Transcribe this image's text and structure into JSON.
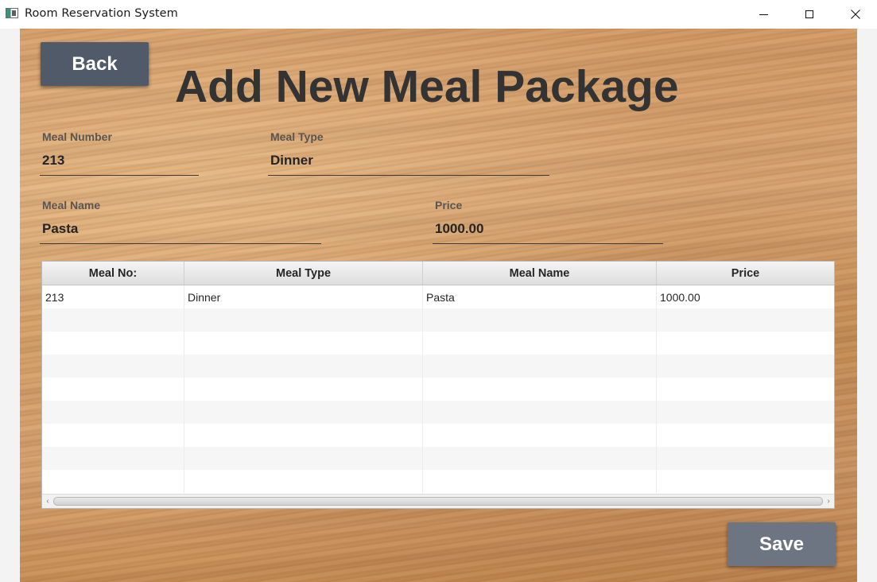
{
  "window": {
    "title": "Room Reservation System",
    "controls": {
      "minimize": "minimize-icon",
      "maximize": "maximize-icon",
      "close": "close-icon"
    }
  },
  "header": {
    "back_label": "Back",
    "title": "Add New Meal Package"
  },
  "form": {
    "meal_number": {
      "label": "Meal Number",
      "value": "213"
    },
    "meal_type": {
      "label": "Meal Type",
      "value": "Dinner"
    },
    "meal_name": {
      "label": "Meal Name",
      "value": "Pasta"
    },
    "price": {
      "label": "Price",
      "value": "1000.00"
    }
  },
  "table": {
    "columns": [
      "Meal No:",
      "Meal Type",
      "Meal Name",
      "Price"
    ],
    "rows": [
      [
        "213",
        "Dinner",
        "Pasta",
        "1000.00"
      ]
    ],
    "empty_rows_visible": 8
  },
  "footer": {
    "save_label": "Save"
  },
  "colors": {
    "back_button": "#515a69",
    "save_button": "#6d7582",
    "title_text": "#333333",
    "wood_base": "#d29b66"
  }
}
